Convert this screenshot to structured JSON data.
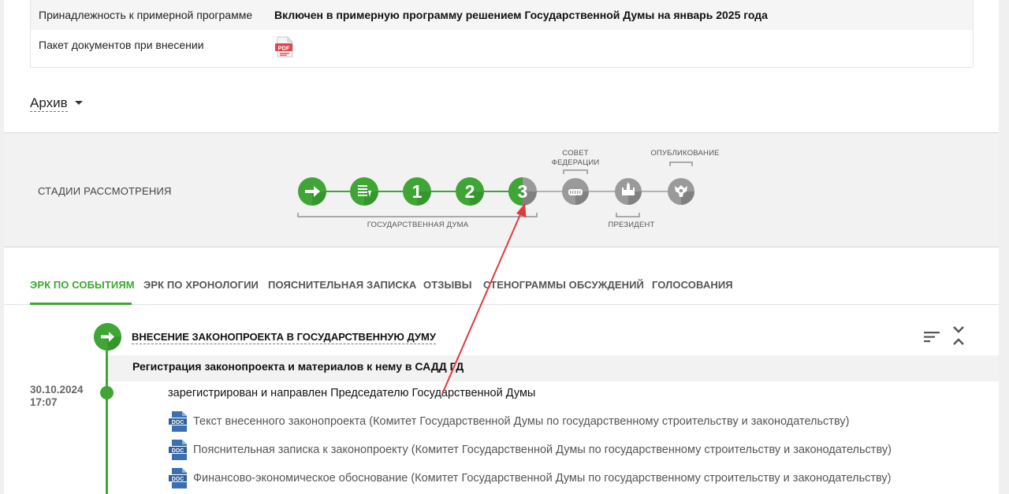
{
  "info": {
    "rows": [
      {
        "label": "Принадлежность к примерной программе",
        "value": "Включен в примерную программу решением Государственной Думы на январь 2025 года"
      },
      {
        "label": "Пакет документов при внесении",
        "file_type": "PDF"
      }
    ]
  },
  "archive": {
    "label": "Архив"
  },
  "stages": {
    "title": "СТАДИИ РАССМОТРЕНИЯ",
    "state_duma_label": "ГОСУДАРСТВЕННАЯ ДУМА",
    "federation_council_label_line1": "СОВЕТ",
    "federation_council_label_line2": "ФЕДЕРАЦИИ",
    "president_label": "ПРЕЗИДЕНТ",
    "publication_label": "ОПУБЛИКОВАНИЕ",
    "steps": [
      {
        "id": "introduction",
        "icon": "arrow-right-icon",
        "status": "done"
      },
      {
        "id": "preliminary",
        "icon": "document-list-icon",
        "status": "done"
      },
      {
        "id": "reading-1",
        "number": "1",
        "status": "done"
      },
      {
        "id": "reading-2",
        "number": "2",
        "status": "done"
      },
      {
        "id": "reading-3",
        "number": "3",
        "status": "partial"
      },
      {
        "id": "federation-council",
        "icon": "council-building-icon",
        "status": "pending"
      },
      {
        "id": "president",
        "icon": "kremlin-icon",
        "status": "pending"
      },
      {
        "id": "publication",
        "icon": "eagle-emblem-icon",
        "status": "pending"
      }
    ],
    "colors": {
      "done": "#3fa535",
      "pending": "#9a9a9a",
      "line_done": "#3fa535",
      "line_pending": "#b3b3b3"
    }
  },
  "tabs": [
    {
      "label": "ЭРК ПО СОБЫТИЯМ",
      "active": true
    },
    {
      "label": "ЭРК ПО ХРОНОЛОГИИ",
      "active": false
    },
    {
      "label": "ПОЯСНИТЕЛЬНАЯ ЗАПИСКА",
      "active": false
    },
    {
      "label": "ОТЗЫВЫ",
      "active": false
    },
    {
      "label": "СТЕНОГРАММЫ ОБСУЖДЕНИЙ",
      "active": false
    },
    {
      "label": "ГОЛОСОВАНИЯ",
      "active": false
    }
  ],
  "events": {
    "section_title": "ВНЕСЕНИЕ ЗАКОНОПРОЕКТА В ГОСУДАРСТВЕННУЮ ДУМУ",
    "registration_title": "Регистрация законопроекта и материалов к нему в САДД ГД",
    "date": "30.10.2024",
    "time": "17:07",
    "description": "зарегистрирован и направлен Председателю Государственной Думы",
    "doc_badge": "DOC",
    "documents": [
      "Текст внесенного законопроекта (Комитет Государственной Думы по государственному строительству и законодательству)",
      "Пояснительная записка к законопроекту (Комитет Государственной Думы по государственному строительству и законодательству)",
      "Финансово-экономическое обоснование (Комитет Государственной Думы по государственному строительству и законодательству)"
    ]
  },
  "accent_color": "#3fa535",
  "annotation_arrow_color": "#e03a3a"
}
